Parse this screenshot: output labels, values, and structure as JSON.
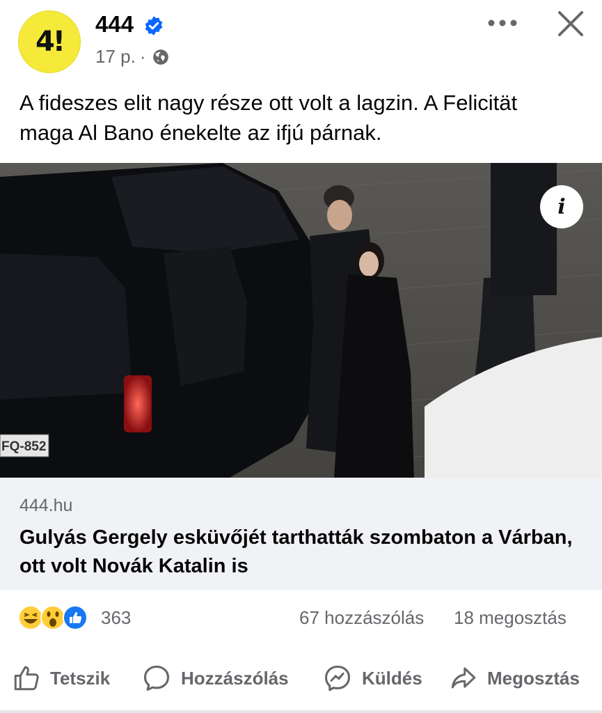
{
  "post": {
    "page_name": "444",
    "avatar_text": "4!",
    "time": "17 p.",
    "separator": "·",
    "text": "A fideszes elit nagy része ott volt a lagzin. A Felicität maga Al Bano énekelte az ifjú párnak."
  },
  "photo": {
    "plate": "FQ-852",
    "info_label": "i"
  },
  "link": {
    "domain": "444.hu",
    "title": "Gulyás Gergely esküvőjét tarthatták szombaton a Várban, ott volt Novák Katalin is"
  },
  "stats": {
    "reactions_count": "363",
    "comments": "67 hozzászólás",
    "shares": "18 megosztás",
    "reaction_icons": [
      "haha-icon",
      "wow-icon",
      "like-icon"
    ]
  },
  "actions": {
    "like": "Tetszik",
    "comment": "Hozzászólás",
    "send": "Küldés",
    "share": "Megosztás"
  },
  "colors": {
    "brand_yellow": "#f5ea3a",
    "verified_blue": "#0866ff",
    "secondary_text": "#65676b",
    "link_bg": "#f0f2f5"
  }
}
